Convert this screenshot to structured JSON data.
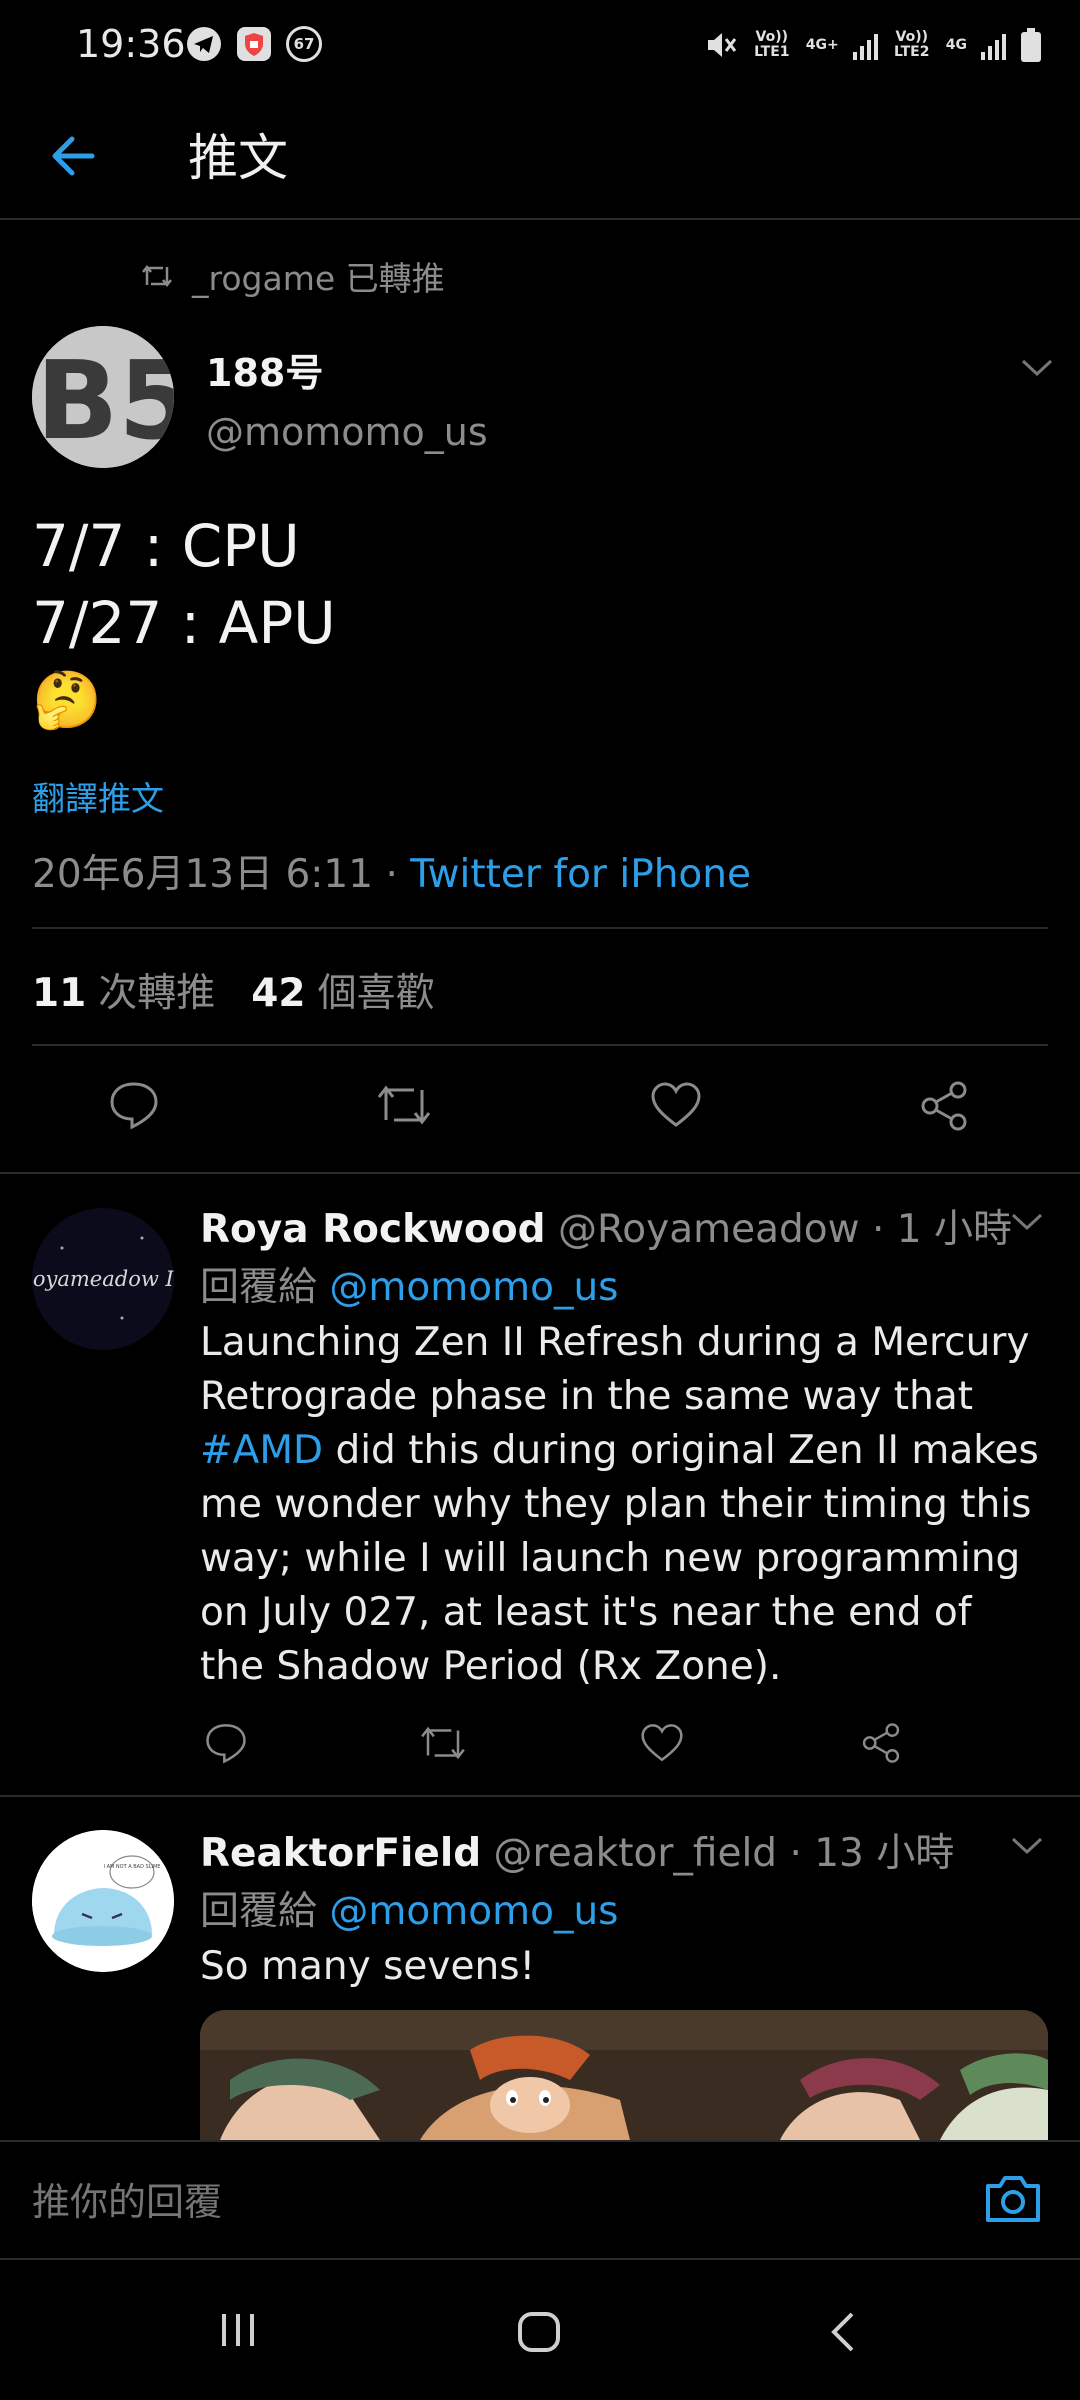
{
  "status_bar": {
    "time": "19:36",
    "notification_count": "67",
    "sim1_label": "Vo)) LTE1",
    "sim1_net": "4G+",
    "sim2_label": "Vo)) LTE2",
    "sim2_net": "4G",
    "icons": [
      "telegram-icon",
      "app-shield-icon",
      "notification-count-icon",
      "mute-icon",
      "signal-icon",
      "battery-icon"
    ]
  },
  "header": {
    "title": "推文"
  },
  "tweet": {
    "retweeted_by": "_rogame 已轉推",
    "display_name": "188号",
    "handle": "@momomo_us",
    "text_line1": "7/7 : CPU",
    "text_line2": "7/27 : APU",
    "emoji": "🤔",
    "translate": "翻譯推文",
    "timestamp": "20年6月13日 6:11 · ",
    "source": "Twitter for iPhone",
    "retweet_count": "11",
    "retweet_label": "次轉推",
    "like_count": "42",
    "like_label": "個喜歡"
  },
  "replies": [
    {
      "display_name": "Roya Rockwood",
      "handle_time": " @Royameadow · 1 小時",
      "reply_to_prefix": "回覆給 ",
      "reply_to": "@momomo_us",
      "body_part1": "Launching Zen II Refresh during a Mercury Retrograde phase in the same way that ",
      "hashtag": "#AMD",
      "body_part2": " did this during original Zen II makes me wonder why they plan their timing this way; while I will launch new programming on July 027, at least it's near the end of the Shadow Period (Rx Zone).",
      "avatar_text": "Royameadow IV"
    },
    {
      "display_name": "ReaktorField",
      "handle_time": " @reaktor_field · 13 小時",
      "reply_to_prefix": "回覆給 ",
      "reply_to": "@momomo_us",
      "body": "So many sevens!",
      "avatar_text": "I AM NOT A BAD SLIME"
    }
  ],
  "reply_bar": {
    "placeholder": "推你的回覆"
  },
  "colors": {
    "accent": "#2d9ee8",
    "background": "#000000",
    "muted": "#8c8c8c"
  }
}
